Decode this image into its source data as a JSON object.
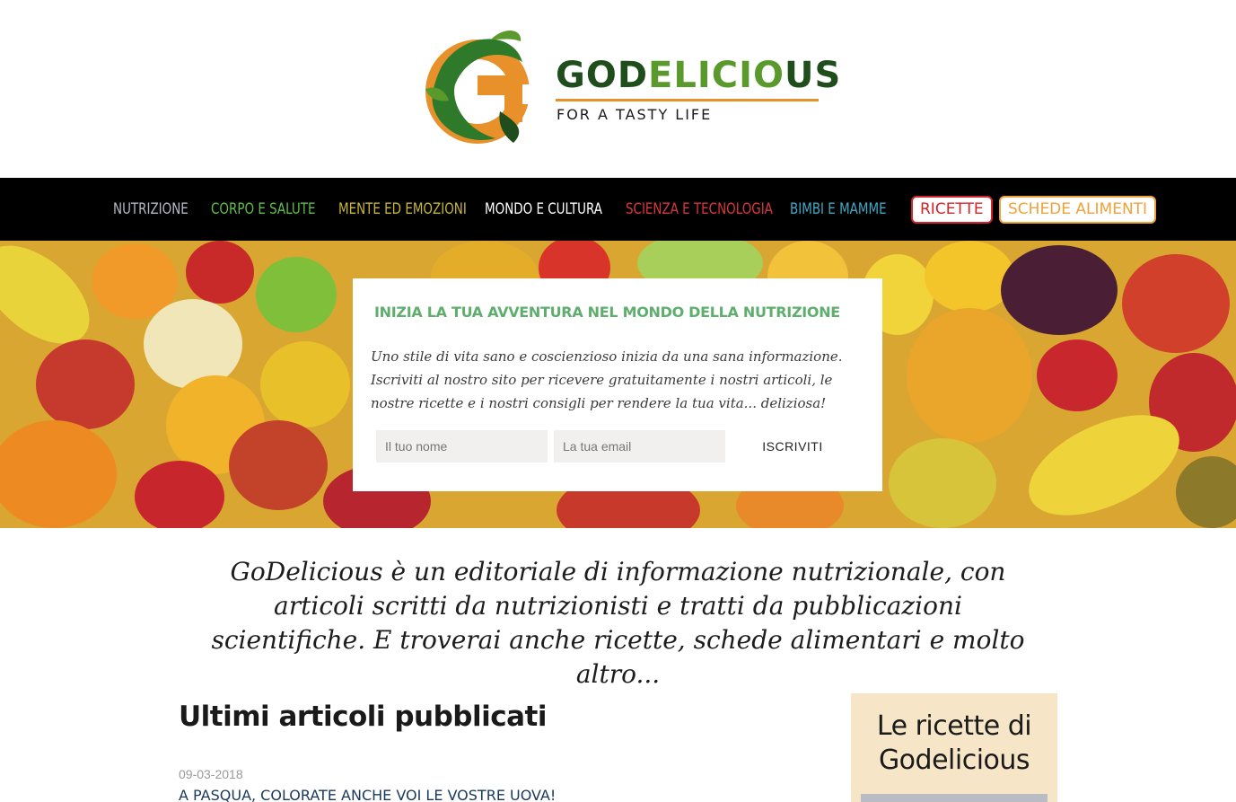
{
  "brand": {
    "name_part1": "GOD",
    "name_part2": "ELICIO",
    "name_part3": "US",
    "tagline": "FOR A TASTY LIFE",
    "colors": {
      "dark_green": "#1f4d1c",
      "green": "#5a9a2c",
      "orange": "#e8912b"
    }
  },
  "nav": {
    "items": [
      {
        "label": "NUTRIZIONE",
        "color": "#b8b8c8"
      },
      {
        "label": "CORPO E SALUTE",
        "color": "#5fbf4a"
      },
      {
        "label": "MENTE ED EMOZIONI",
        "color": "#c9b63a"
      },
      {
        "label": "MONDO E CULTURA",
        "color": "#ffffff"
      },
      {
        "label": "SCIENZA E TECNOLOGIA",
        "color": "#d8383f"
      },
      {
        "label": "BIMBI E MAMME",
        "color": "#41a9c4"
      }
    ],
    "boxed": [
      {
        "label": "RICETTE",
        "color": "#d1232a"
      },
      {
        "label": "SCHEDE ALIMENTI",
        "color": "#efa13a"
      }
    ]
  },
  "signup": {
    "title": "INIZIA LA TUA AVVENTURA NEL MONDO DELLA NUTRIZIONE",
    "text": "Uno stile di vita sano e coscienzioso inizia da una sana informazione. Iscriviti al nostro sito per ricevere gratuitamente i nostri articoli, le nostre ricette e i nostri consigli per rendere la tua vita... deliziosa!",
    "name_placeholder": "Il tuo nome",
    "email_placeholder": "La tua email",
    "button_label": "ISCRIVITI"
  },
  "intro": "GoDelicious è un editoriale di informazione nutrizionale, con articoli scritti da nutrizionisti e tratti da pubblicazioni scientifiche. E troverai anche ricette, schede alimentari e molto altro...",
  "articles": {
    "section_title": "Ultimi articoli pubblicati",
    "items": [
      {
        "date": "09-03-2018",
        "title": "A PASQUA, COLORATE ANCHE VOI LE VOSTRE UOVA!"
      }
    ]
  },
  "sidebar": {
    "widget_title": "Le ricette di Godelicious"
  }
}
